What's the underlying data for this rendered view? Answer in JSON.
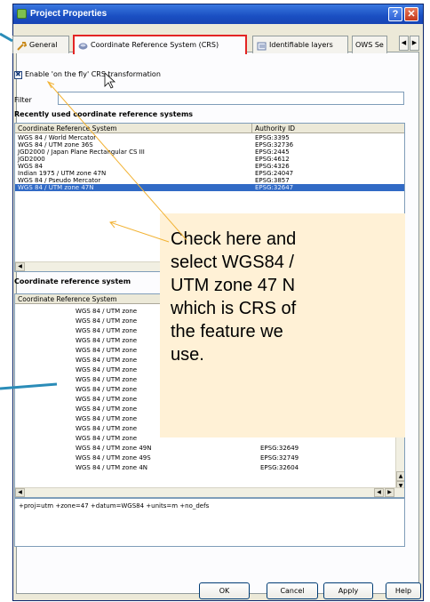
{
  "window": {
    "title": "Project Properties",
    "help_glyph": "?",
    "close_glyph": "✕"
  },
  "tabs": [
    {
      "label": "General",
      "icon": "wrench-icon"
    },
    {
      "label": "Coordinate Reference System (CRS)",
      "icon": "globe-icon",
      "active": true
    },
    {
      "label": "Identifiable layers",
      "icon": "layers-icon"
    },
    {
      "label": "OWS Se",
      "icon": ""
    }
  ],
  "tab_scroll": {
    "left": "◀",
    "right": "▶"
  },
  "otf": {
    "label": "Enable 'on the fly' CRS transformation",
    "checked": true
  },
  "filter": {
    "label": "Filter",
    "value": ""
  },
  "recent": {
    "title": "Recently used coordinate reference systems",
    "columns": [
      "Coordinate Reference System",
      "Authority ID"
    ],
    "rows": [
      {
        "name": "WGS 84 / World Mercator",
        "id": "EPSG:3395"
      },
      {
        "name": "WGS 84 / UTM zone 36S",
        "id": "EPSG:32736"
      },
      {
        "name": "JGD2000 / Japan Plane Rectangular CS III",
        "id": "EPSG:2445"
      },
      {
        "name": "JGD2000",
        "id": "EPSG:4612"
      },
      {
        "name": "WGS 84",
        "id": "EPSG:4326"
      },
      {
        "name": "Indian 1975 / UTM zone 47N",
        "id": "EPSG:24047"
      },
      {
        "name": "WGS 84 / Pseudo Mercator",
        "id": "EPSG:3857"
      },
      {
        "name": "WGS 84 / UTM zone 47N",
        "id": "EPSG:32647",
        "selected": true
      }
    ]
  },
  "crs": {
    "title": "Coordinate reference system",
    "columns": [
      "Coordinate Reference System"
    ],
    "rows": [
      {
        "name": "WGS 84 / UTM zone",
        "id": ""
      },
      {
        "name": "WGS 84 / UTM zone",
        "id": ""
      },
      {
        "name": "WGS 84 / UTM zone",
        "id": ""
      },
      {
        "name": "WGS 84 / UTM zone",
        "id": ""
      },
      {
        "name": "WGS 84 / UTM zone",
        "id": ""
      },
      {
        "name": "WGS 84 / UTM zone",
        "id": ""
      },
      {
        "name": "WGS 84 / UTM zone",
        "id": ""
      },
      {
        "name": "WGS 84 / UTM zone",
        "id": ""
      },
      {
        "name": "WGS 84 / UTM zone",
        "id": ""
      },
      {
        "name": "WGS 84 / UTM zone",
        "id": ""
      },
      {
        "name": "WGS 84 / UTM zone",
        "id": ""
      },
      {
        "name": "WGS 84 / UTM zone",
        "id": ""
      },
      {
        "name": "WGS 84 / UTM zone",
        "id": ""
      },
      {
        "name": "WGS 84 / UTM zone",
        "id": ""
      },
      {
        "name": "WGS 84 / UTM zone 49N",
        "id": "EPSG:32649"
      },
      {
        "name": "WGS 84 / UTM zone 49S",
        "id": "EPSG:32749"
      },
      {
        "name": "WGS 84 / UTM zone 4N",
        "id": "EPSG:32604"
      }
    ]
  },
  "proj_string": "+proj=utm +zone=47 +datum=WGS84 +units=m +no_defs",
  "buttons": {
    "ok": "OK",
    "cancel": "Cancel",
    "apply": "Apply",
    "help": "Help"
  },
  "callout": {
    "lines": [
      "Check here and",
      "select WGS84 /",
      "UTM zone 47 N",
      "which is CRS of",
      "the feature we",
      "use."
    ],
    "background": "#fff1d6",
    "arrow_color": "#f2b233"
  },
  "colors": {
    "selection": "#316ac5",
    "highlight_border": "#e32424",
    "titlebar": "#1a4fc2"
  }
}
